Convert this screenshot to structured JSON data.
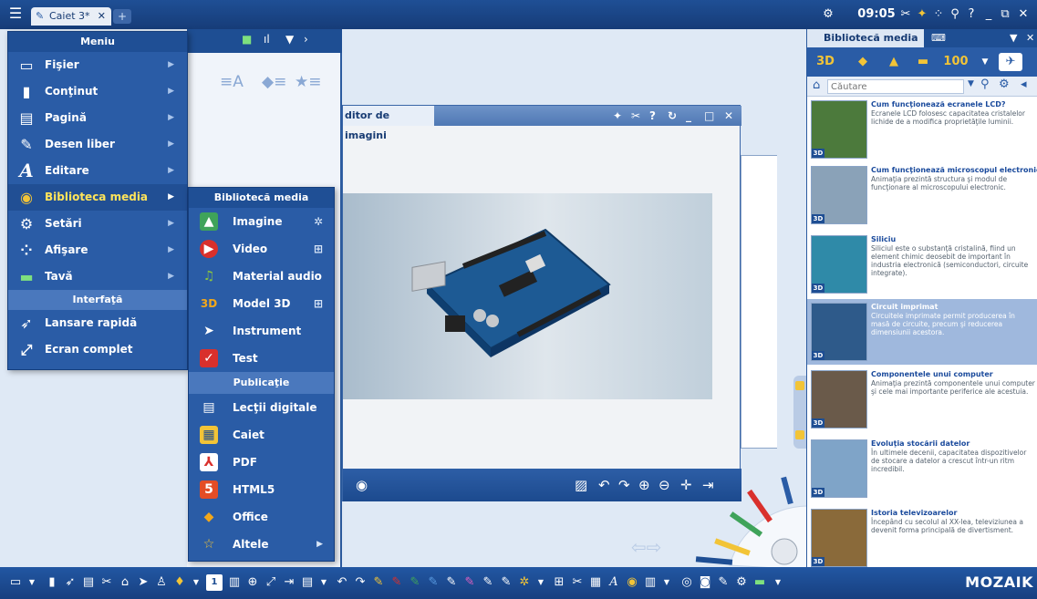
{
  "topbar": {
    "tab_label": "Caiet 3*",
    "tab_close": "✕",
    "new_tab": "+",
    "clock": "09:05",
    "help": "?"
  },
  "menu": {
    "title": "Meniu",
    "items": [
      {
        "label": "Fişier",
        "icon": "folder-icon"
      },
      {
        "label": "Conţinut",
        "icon": "content-icon"
      },
      {
        "label": "Pagină",
        "icon": "page-icon"
      },
      {
        "label": "Desen liber",
        "icon": "brush-icon"
      },
      {
        "label": "Editare",
        "icon": "text-icon"
      },
      {
        "label": "Biblioteca media",
        "icon": "media-icon"
      },
      {
        "label": "Setări",
        "icon": "gear-icon"
      },
      {
        "label": "Afişare",
        "icon": "grid-icon"
      },
      {
        "label": "Tavă",
        "icon": "tray-icon"
      }
    ],
    "section_interface": "Interfaţă",
    "bottom_items": [
      {
        "label": "Lansare rapidă",
        "icon": "rocket-icon"
      },
      {
        "label": "Ecran complet",
        "icon": "fullscreen-icon"
      }
    ],
    "active_item": "Biblioteca media"
  },
  "submenu": {
    "title": "Bibliotecă media",
    "items": [
      {
        "label": "Imagine",
        "icon": "image-icon",
        "color": "#3fa35a"
      },
      {
        "label": "Video",
        "icon": "video-icon",
        "color": "#d9302c"
      },
      {
        "label": "Material audio",
        "icon": "audio-icon",
        "color": "#8bc53f"
      },
      {
        "label": "Model 3D",
        "icon": "3d-icon",
        "color": "#f2a71b"
      },
      {
        "label": "Instrument",
        "icon": "tool-icon",
        "color": "#2a5ca6"
      },
      {
        "label": "Test",
        "icon": "test-icon",
        "color": "#d9302c"
      }
    ],
    "section_publication": "Publicaţie",
    "pub_items": [
      {
        "label": "Lecţii digitale",
        "icon": "lesson-icon",
        "color": "#2a5ca6"
      },
      {
        "label": "Caiet",
        "icon": "notebook-icon",
        "color": "#f2c437"
      },
      {
        "label": "PDF",
        "icon": "pdf-icon",
        "color": "#d9302c"
      },
      {
        "label": "HTML5",
        "icon": "html5-icon",
        "color": "#e44d26"
      },
      {
        "label": "Office",
        "icon": "office-icon",
        "color": "#f2a71b"
      },
      {
        "label": "Altele",
        "icon": "star-icon",
        "color": "#f2c437"
      }
    ]
  },
  "editor": {
    "title": "ditor de imagini",
    "window_controls": [
      "?",
      "_",
      "□",
      "✕"
    ]
  },
  "media_panel": {
    "tab": "Bibliotecă media",
    "filters": [
      "3D",
      "100"
    ],
    "search_placeholder": "Căutare",
    "items": [
      {
        "title": "Cum funcţionează ecranele LCD?",
        "desc": "Ecranele LCD folosesc capacitatea cristalelor lichide de a modifica proprietăţile luminii.",
        "selected": false,
        "thumb": "#4c7a3c"
      },
      {
        "title": "Cum funcţionează microscopul electronic?",
        "desc": "Animaţia prezintă structura şi modul de funcţionare al microscopului electronic.",
        "selected": false,
        "thumb": "#8aa2b8"
      },
      {
        "title": "Siliciu",
        "desc": "Siliciul este o substanţă cristalină, fiind un element chimic deosebit de important în industria electronică (semiconductori, circuite integrate).",
        "selected": false,
        "thumb": "#2f8aa8"
      },
      {
        "title": "Circuit imprimat",
        "desc": "Circuitele imprimate permit producerea în masă de circuite, precum şi reducerea dimensiunii acestora.",
        "selected": true,
        "thumb": "#2e5a8a"
      },
      {
        "title": "Componentele unui computer",
        "desc": "Animaţia prezintă componentele unui computer şi cele mai importante periferice ale acestuia.",
        "selected": false,
        "thumb": "#6a5a4a"
      },
      {
        "title": "Evoluţia stocării datelor",
        "desc": "În ultimele decenii, capacitatea dispozitivelor de stocare a datelor a crescut într-un ritm incredibil.",
        "selected": false,
        "thumb": "#7fa4c8"
      },
      {
        "title": "Istoria televizoarelor",
        "desc": "Începând cu secolul al XX-lea, televiziunea a devenit forma principală de divertisment.",
        "selected": false,
        "thumb": "#8a6a3a"
      }
    ]
  },
  "bottombar": {
    "page_number": "1",
    "brand": "MOZAIK"
  }
}
